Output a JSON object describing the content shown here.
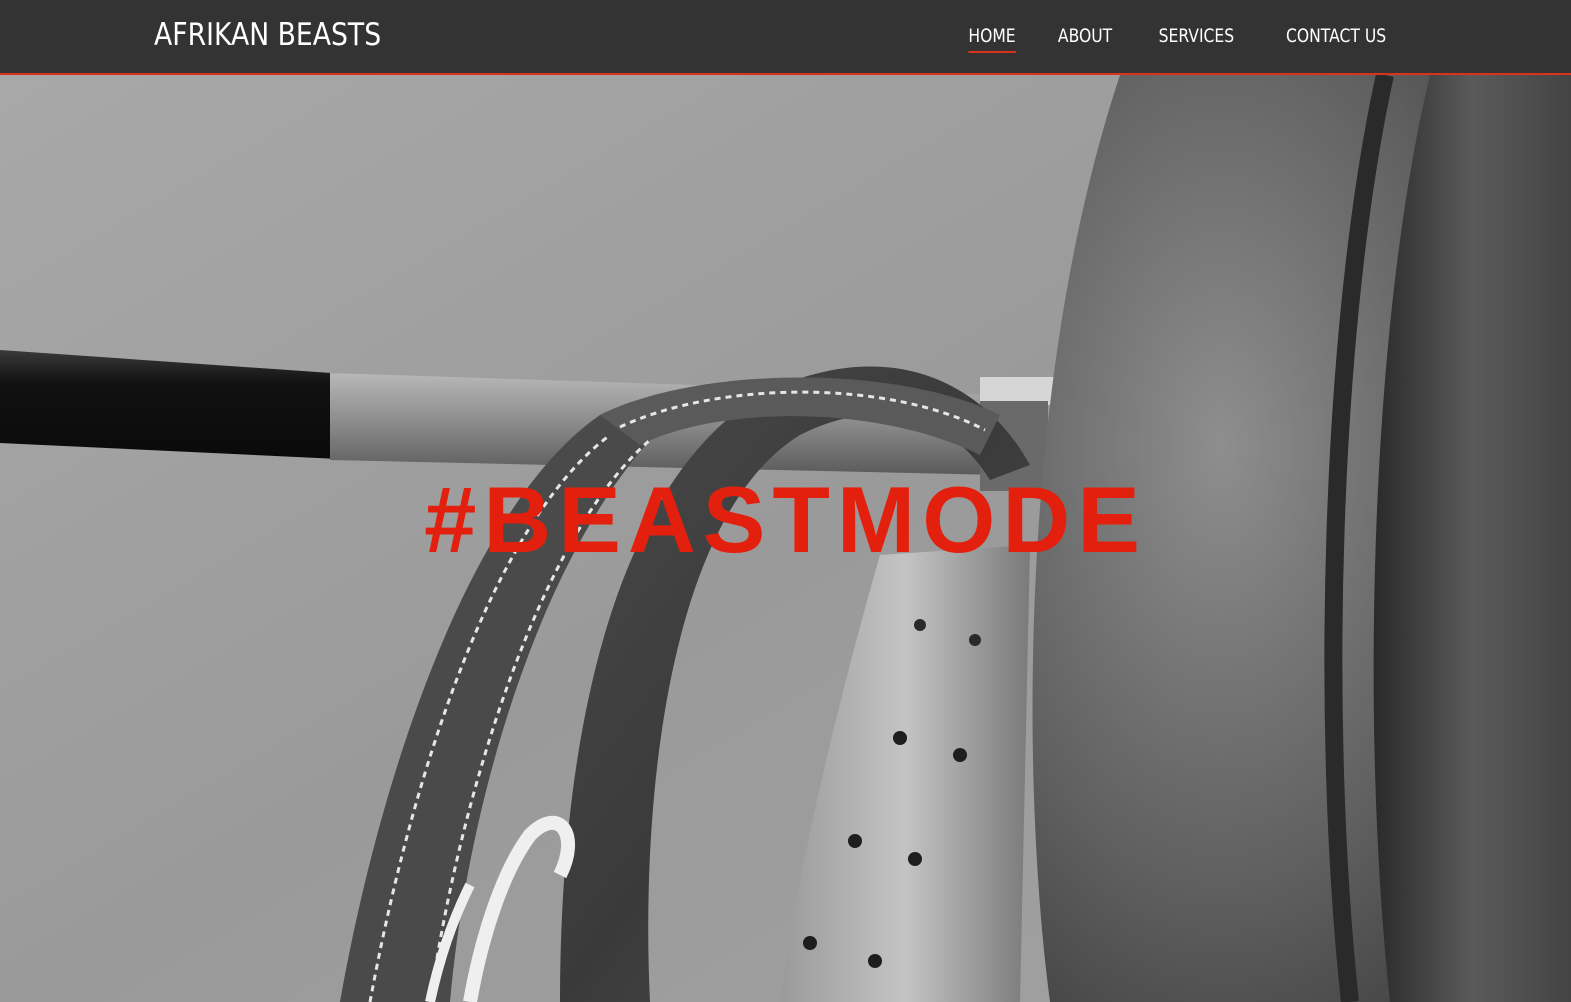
{
  "header": {
    "brand": "AFRIKAN BEASTS",
    "nav": [
      {
        "label": "HOME",
        "active": true
      },
      {
        "label": "ABOUT",
        "active": false
      },
      {
        "label": "SERVICES",
        "active": false
      },
      {
        "label": "CONTACT US",
        "active": false
      }
    ]
  },
  "hero": {
    "headline": "#BEASTMODE"
  },
  "colors": {
    "accent": "#e3200e",
    "navbar": "#333333",
    "nav_underline": "#d9321f"
  }
}
